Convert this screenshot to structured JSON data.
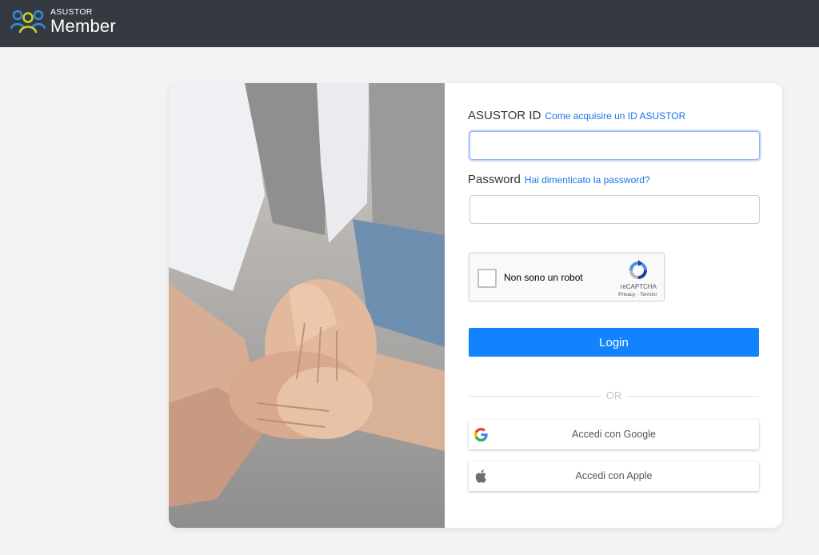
{
  "header": {
    "brand_small": "ASUSTOR",
    "brand_big": "Member",
    "logo_icon": "people-group-icon",
    "background": "#353a40"
  },
  "login": {
    "id_label": "ASUSTOR ID",
    "id_help_link": "Come acquisire un ID ASUSTOR",
    "id_value": "",
    "password_label": "Password",
    "password_help_link": "Hai dimenticato la password?",
    "password_value": ""
  },
  "captcha": {
    "label": "Non sono un robot",
    "brand": "reCAPTCHA",
    "legal": "Privacy - Termini",
    "icon": "recaptcha-icon",
    "checked": false
  },
  "actions": {
    "login_label": "Login",
    "login_color": "#1283fd",
    "divider_text": "OR",
    "google_label": "Accedi con Google",
    "google_icon": "google-icon",
    "apple_label": "Accedi con Apple",
    "apple_icon": "apple-icon"
  },
  "colors": {
    "link": "#1a73e8",
    "page_background": "#f3f3f3"
  }
}
